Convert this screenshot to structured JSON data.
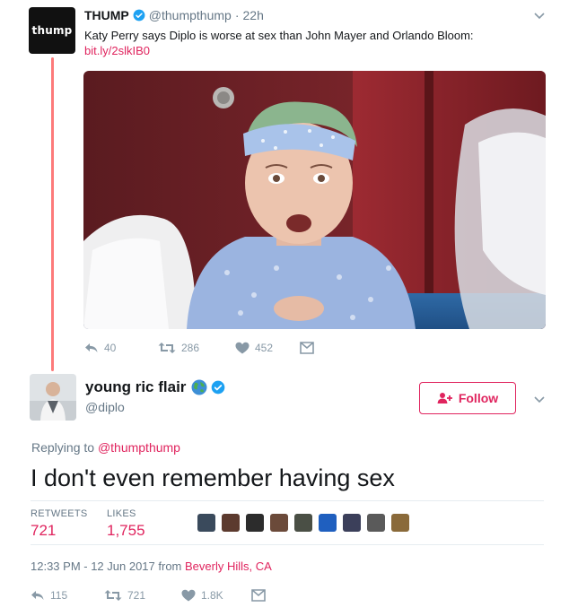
{
  "parent_tweet": {
    "avatar_text": "thump",
    "name": "THUMP",
    "handle": "@thumpthump",
    "separator": "·",
    "time": "22h",
    "text": "Katy Perry says Diplo is worse at sex than John Mayer and Orlando Bloom:",
    "link": "bit.ly/2slkIB0",
    "replies": "40",
    "retweets": "286",
    "likes": "452"
  },
  "main_tweet": {
    "name": "young ric flair",
    "handle": "@diplo",
    "follow_label": "Follow",
    "replying_prefix": "Replying to",
    "replying_to": "@thumpthump",
    "text": "I don't even remember having sex",
    "retweets_label": "RETWEETS",
    "retweets_value": "721",
    "likes_label": "LIKES",
    "likes_value": "1,755",
    "timestamp": "12:33 PM - 12 Jun 2017 from",
    "location": "Beverly Hills, CA",
    "action_replies": "115",
    "action_retweets": "721",
    "action_likes": "1.8K"
  },
  "colors": {
    "accent": "#e0245e",
    "thread_line": "#fd7a7a",
    "verified": "#1da1f2",
    "muted": "#657786"
  },
  "icons": [
    "verified-badge-icon",
    "chevron-down-icon",
    "reply-icon",
    "retweet-icon",
    "heart-icon",
    "direct-message-icon",
    "follow-person-icon",
    "globe-emoji-icon"
  ]
}
